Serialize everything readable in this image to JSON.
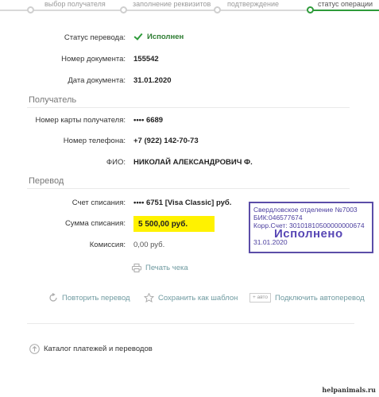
{
  "stepper": {
    "steps": [
      {
        "label": "выбор получателя",
        "state": "done"
      },
      {
        "label": "заполнение реквизитов",
        "state": "done"
      },
      {
        "label": "подтверждение",
        "state": "done"
      },
      {
        "label": "статус операции",
        "state": "active"
      }
    ]
  },
  "details": {
    "status_label": "Статус перевода:",
    "status_value": "Исполнен",
    "doc_number_label": "Номер документа:",
    "doc_number_value": "155542",
    "doc_date_label": "Дата документа:",
    "doc_date_value": "31.01.2020"
  },
  "recipient": {
    "section_title": "Получатель",
    "card_label": "Номер карты получателя:",
    "card_value": "•••• 6689",
    "phone_label": "Номер телефона:",
    "phone_value": "+7 (922) 142-70-73",
    "name_label": "ФИО:",
    "name_value": "НИКОЛАЙ АЛЕКСАНДРОВИЧ Ф."
  },
  "transfer": {
    "section_title": "Перевод",
    "account_label": "Счет списания:",
    "account_value": "•••• 6751  [Visa Classic]  руб.",
    "amount_label": "Сумма списания:",
    "amount_value": "5 500,00  руб.",
    "fee_label": "Комиссия:",
    "fee_value": "0,00 руб."
  },
  "actions": {
    "print_label": "Печать чека",
    "repeat_label": "Повторить перевод",
    "template_label": "Сохранить как шаблон",
    "autopay_badge": "+ авто",
    "autopay_label": "Подключить автоперевод",
    "catalog_label": "Каталог платежей и переводов"
  },
  "stamp": {
    "line1": "Свердловское отделение №7003",
    "line2": "БИК:046577674",
    "line3": "Корр.Счет: 30101810500000000674",
    "status": "Исполнено",
    "date": "31.01.2020"
  },
  "watermark": "helpanimals.ru",
  "colors": {
    "accent_green": "#2e9b3a",
    "highlight_yellow": "#fff200",
    "stamp_purple": "#5b4da8",
    "link_teal": "#6f9aa0"
  }
}
